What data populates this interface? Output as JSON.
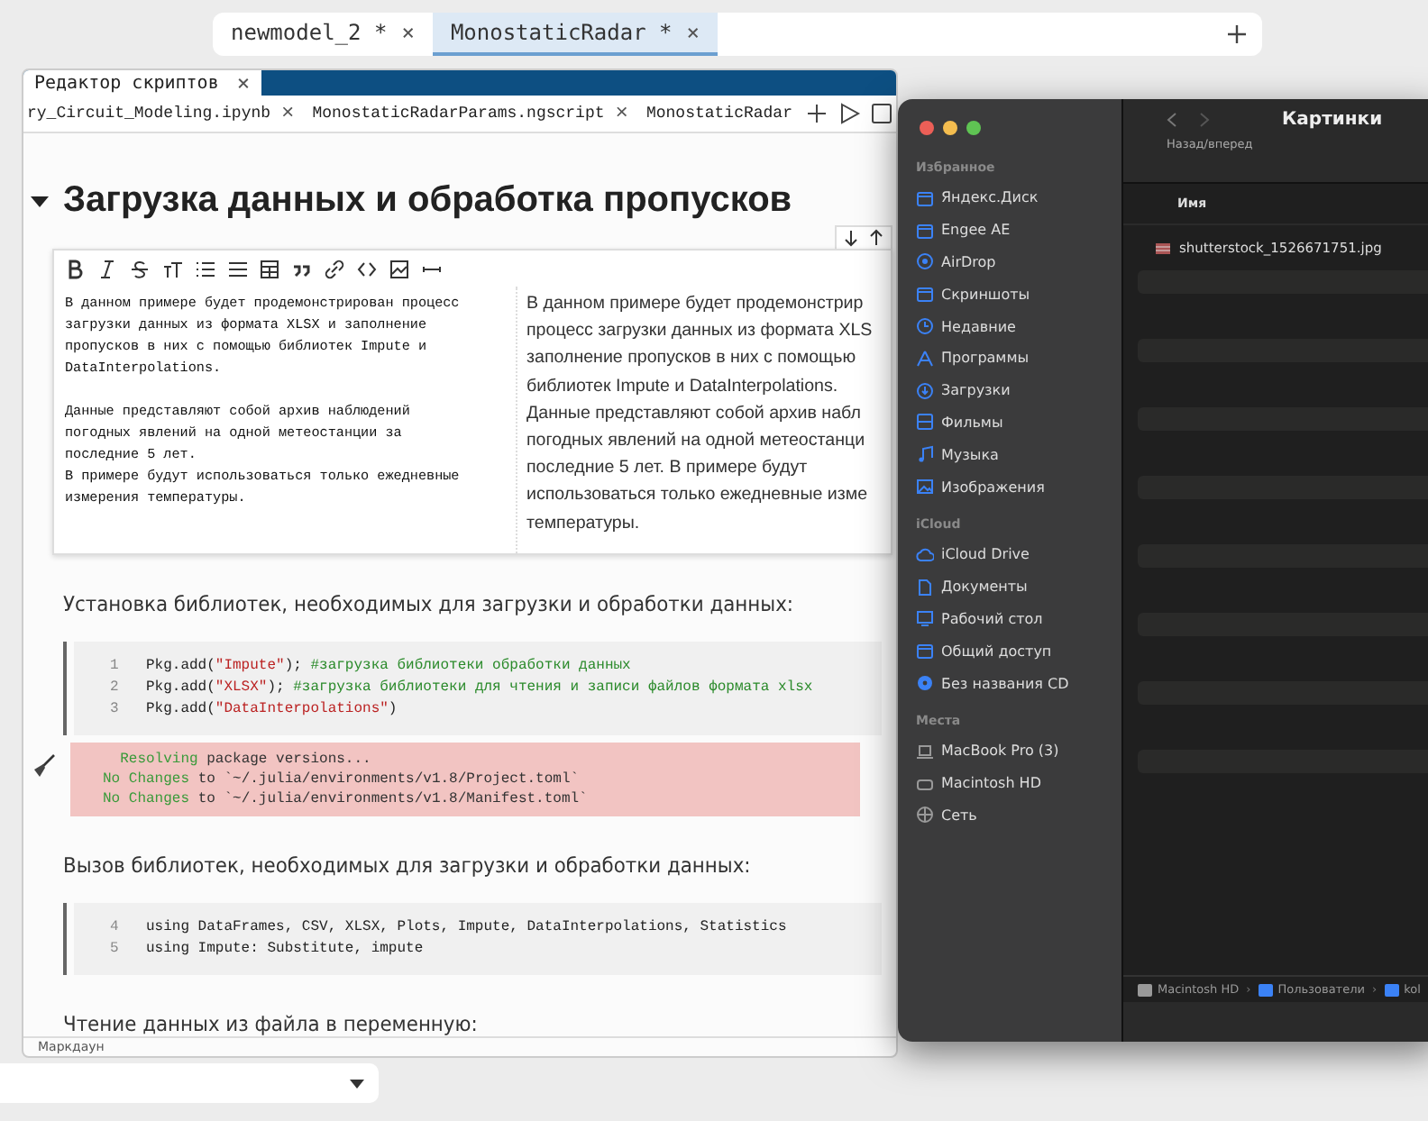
{
  "top_tabs": [
    {
      "label": "newmodel_2 *",
      "close": "×",
      "selected": false
    },
    {
      "label": "MonostaticRadar *",
      "close": "×",
      "selected": true
    }
  ],
  "editor": {
    "panel_tab": {
      "label": "Редактор скриптов",
      "close": "×"
    },
    "file_tabs": [
      {
        "label": "ry_Circuit_Modeling.ipynb",
        "close": "×"
      },
      {
        "label": "MonostaticRadarParams.ngscript",
        "close": "×"
      },
      {
        "label": "MonostaticRadar"
      }
    ],
    "heading": "Загрузка данных и обработка пропусков",
    "heading_expanded": true,
    "markdown_cell": {
      "source_paragraphs": [
        [
          "В данном примере будет продемонстрирован процесс",
          "загрузки данных из формата XLSX и заполнение",
          "пропусков в них с помощью библиотек Impute и",
          "DataInterpolations."
        ],
        [
          "Данные представляют собой архив наблюдений",
          "погодных явлений на одной метеостанции за",
          "последние 5 лет.",
          "В примере будут использоваться только ежедневные",
          "измерения температуры."
        ]
      ],
      "preview_lines": [
        "В данном примере будет продемонстрир",
        "процесс загрузки данных из формата XLS",
        "заполнение пропусков в них с помощью",
        "библиотек Impute и DataInterpolations.",
        "Данные представляют собой архив набл",
        "погодных явлений на одной метеостанци",
        "последние 5 лет. В примере будут",
        "использоваться только ежедневные изме",
        "температуры."
      ]
    },
    "cells": [
      {
        "kind": "text",
        "text": "Установка библиотек, необходимых для загрузки и обработки данных:"
      },
      {
        "kind": "code",
        "lines": [
          {
            "number": "1",
            "tokens": [
              {
                "kind": "plain",
                "text": "Pkg.add("
              },
              {
                "kind": "string",
                "text": "\"Impute\""
              },
              {
                "kind": "plain",
                "text": "); "
              },
              {
                "kind": "comment",
                "text": "#загрузка библиотеки обработки данных"
              }
            ]
          },
          {
            "number": "2",
            "tokens": [
              {
                "kind": "plain",
                "text": "Pkg.add("
              },
              {
                "kind": "string",
                "text": "\"XLSX\""
              },
              {
                "kind": "plain",
                "text": "); "
              },
              {
                "kind": "comment",
                "text": "#загрузка библиотеки для чтения и записи файлов формата xlsx"
              }
            ]
          },
          {
            "number": "3",
            "tokens": [
              {
                "kind": "plain",
                "text": "Pkg.add("
              },
              {
                "kind": "string",
                "text": "\"DataInterpolations\""
              },
              {
                "kind": "plain",
                "text": ")"
              }
            ]
          }
        ]
      },
      {
        "kind": "output",
        "lines": [
          [
            {
              "kind": "status",
              "text": "  Resolving"
            },
            {
              "kind": "plain",
              "text": " package versions..."
            }
          ],
          [
            {
              "kind": "status",
              "text": "No Changes"
            },
            {
              "kind": "plain",
              "text": " to `~/.julia/environments/v1.8/Project.toml`"
            }
          ],
          [
            {
              "kind": "status",
              "text": "No Changes"
            },
            {
              "kind": "plain",
              "text": " to `~/.julia/environments/v1.8/Manifest.toml`"
            }
          ]
        ]
      },
      {
        "kind": "text",
        "text": "Вызов библиотек, необходимых для загрузки и обработки данных:"
      },
      {
        "kind": "code",
        "lines": [
          {
            "number": "4",
            "tokens": [
              {
                "kind": "plain",
                "text": "using DataFrames, CSV, XLSX, Plots, Impute, DataInterpolations, Statistics"
              }
            ]
          },
          {
            "number": "5",
            "tokens": [
              {
                "kind": "plain",
                "text": "using Impute: Substitute, impute"
              }
            ]
          }
        ]
      },
      {
        "kind": "text",
        "text": "Чтение данных из файла в переменную:"
      }
    ],
    "status_bar": "Маркдаун"
  },
  "finder": {
    "title": "Картинки",
    "nav_label": "Назад/вперед",
    "sections": [
      {
        "title": "Избранное",
        "items": [
          {
            "label": "Яндекс.Диск",
            "kind": "folder"
          },
          {
            "label": "Engee AE",
            "kind": "folder"
          },
          {
            "label": "AirDrop",
            "kind": "airdrop"
          },
          {
            "label": "Скриншоты",
            "kind": "folder"
          },
          {
            "label": "Недавние",
            "kind": "clock"
          },
          {
            "label": "Программы",
            "kind": "apps"
          },
          {
            "label": "Загрузки",
            "kind": "download"
          },
          {
            "label": "Фильмы",
            "kind": "film"
          },
          {
            "label": "Музыка",
            "kind": "music"
          },
          {
            "label": "Изображения",
            "kind": "image"
          }
        ]
      },
      {
        "title": "iCloud",
        "items": [
          {
            "label": "iCloud Drive",
            "kind": "cloud"
          },
          {
            "label": "Документы",
            "kind": "doc"
          },
          {
            "label": "Рабочий стол",
            "kind": "desktop"
          },
          {
            "label": "Общий доступ",
            "kind": "folder"
          },
          {
            "label": "Без названия CD",
            "kind": "disc"
          }
        ]
      },
      {
        "title": "Места",
        "items": [
          {
            "label": "MacBook Pro (3)",
            "kind": "laptop"
          },
          {
            "label": "Macintosh HD",
            "kind": "drive"
          },
          {
            "label": "Сеть",
            "kind": "globe"
          }
        ]
      }
    ],
    "column": "Имя",
    "files": [
      "shutterstock_1526671751.jpg"
    ],
    "path": [
      "Macintosh HD",
      "Пользователи",
      "kol"
    ],
    "path_separator": "›"
  }
}
